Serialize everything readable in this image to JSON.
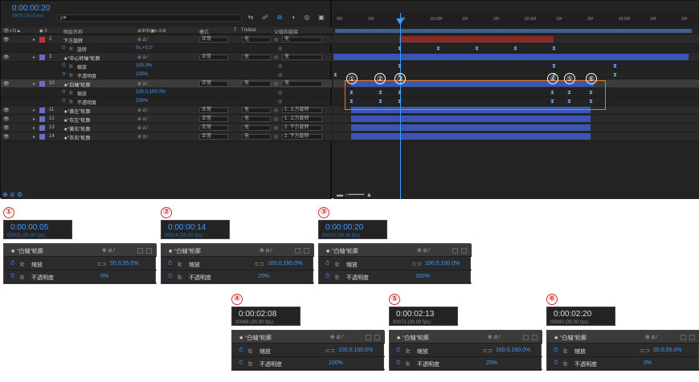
{
  "comp_timecode": "0:00:00:20",
  "comp_timecode_sub": "00020 (30.00 fps)",
  "search_placeholder": "ρ▾",
  "col_headers": {
    "source": "图层名称",
    "mode": "模式",
    "t": "T",
    "trkmat": "TrkMat",
    "parent": "父级和链接"
  },
  "layers": [
    {
      "num": "2",
      "name": "下方旋转",
      "color": "#c8322e",
      "mode": "正常",
      "trk": "无",
      "parent": "无"
    },
    {
      "prop": "旋转",
      "value": "0x,+0.0°"
    },
    {
      "num": "3",
      "name": "★“中心转轴”轮廓",
      "color": "#6b6bc8",
      "mode": "正常",
      "trk": "无",
      "parent": "无"
    },
    {
      "prop": "缩放",
      "value": "100.0%"
    },
    {
      "prop": "不透明度",
      "value": "100%"
    },
    {
      "num": "10",
      "name": "★“白轴”轮廓",
      "color": "#6b6bc8",
      "mode": "正常",
      "trk": "无",
      "parent": "无"
    },
    {
      "prop": "缩放",
      "value": "100.0,100.0%"
    },
    {
      "prop": "不透明度",
      "value": "100%"
    },
    {
      "num": "11",
      "name": "★“黄左”轮廓",
      "color": "#6b6bc8",
      "mode": "正常",
      "trk": "无",
      "parent": "1. 上方旋转"
    },
    {
      "num": "12",
      "name": "★“灰左”轮廓",
      "color": "#6b6bc8",
      "mode": "正常",
      "trk": "无",
      "parent": "1. 上方旋转"
    },
    {
      "num": "13",
      "name": "★“黄右”轮廓",
      "color": "#6b6bc8",
      "mode": "正常",
      "trk": "无",
      "parent": "2. 下方旋转"
    },
    {
      "num": "14",
      "name": "★“灰右”轮廓",
      "color": "#6b6bc8",
      "mode": "正常",
      "trk": "无",
      "parent": "2. 下方旋转"
    }
  ],
  "ruler": [
    "00f",
    "10f",
    "20f",
    "01:00f",
    "10f",
    "20f",
    "02:00f",
    "10f",
    "20f",
    "03:00f",
    "10f",
    "20f"
  ],
  "keyframe_markers": [
    "①",
    "②",
    "③",
    "④",
    "⑤",
    "⑥"
  ],
  "panels": [
    {
      "num": "①",
      "tc": "0:00:00:05",
      "sub": "00005 (30.00 fps)",
      "layer": "★ “白轴”轮廓",
      "scale_label": "缩放",
      "scale": "55.0,55.0%",
      "opacity_label": "不透明度",
      "opacity": "0%"
    },
    {
      "num": "②",
      "tc": "0:00:00:14",
      "sub": "00014 (30.00 fps)",
      "layer": "★ “白轴”轮廓",
      "scale_label": "缩放",
      "scale": "160.0,160.0%",
      "opacity_label": "不透明度",
      "opacity": "25%"
    },
    {
      "num": "③",
      "tc": "0:00:00:20",
      "sub": "00020 (30.00 fps)",
      "layer": "★ “白轴”轮廓",
      "scale_label": "缩放",
      "scale": "100.0,100.0%",
      "opacity_label": "不透明度",
      "opacity": "100%"
    },
    {
      "num": "④",
      "tc": "0:00:02:08",
      "sub": "00068 (30.00 fps)",
      "layer": "★ “白轴”轮廓",
      "scale_label": "缩放",
      "scale": "100.0,100.0%",
      "opacity_label": "不透明度",
      "opacity": "100%"
    },
    {
      "num": "⑤",
      "tc": "0:00:02:13",
      "sub": "00073 (30.00 fps)",
      "layer": "★ “白轴”轮廓",
      "scale_label": "缩放",
      "scale": "160.0,160.0%",
      "opacity_label": "不透明度",
      "opacity": "25%"
    },
    {
      "num": "⑥",
      "tc": "0:00:02:20",
      "sub": "00080 (30.00 fps)",
      "layer": "★ “白轴”轮廓",
      "scale_label": "缩放",
      "scale": "55.0,55.0%",
      "opacity_label": "不透明度",
      "opacity": "0%"
    }
  ]
}
